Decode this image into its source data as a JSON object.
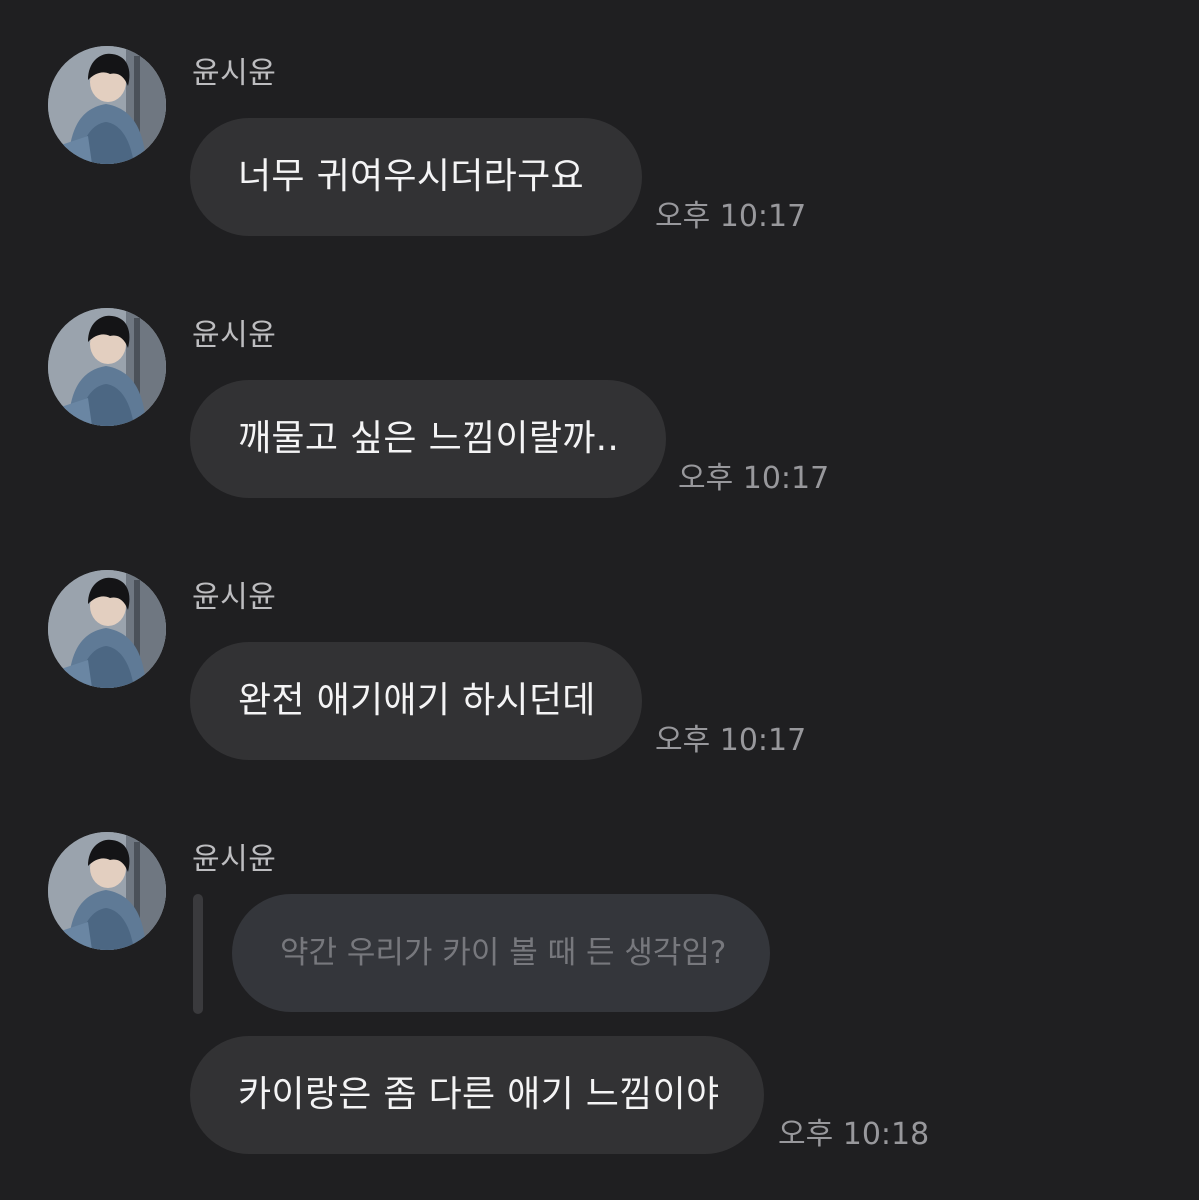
{
  "messages": [
    {
      "sender": "윤시윤",
      "text": "너무 귀여우시더라구요",
      "time": "오후 10:17"
    },
    {
      "sender": "윤시윤",
      "text": "깨물고 싶은 느낌이랄까..",
      "time": "오후 10:17"
    },
    {
      "sender": "윤시윤",
      "text": "완전 애기애기 하시던데",
      "time": "오후 10:17"
    },
    {
      "sender": "윤시윤",
      "quote": "약간 우리가 카이 볼 때 든 생각임?",
      "text": "카이랑은 좀 다른 애기 느낌이야",
      "time": "오후 10:18"
    }
  ],
  "theme": {
    "background": "#1f1f21",
    "bubble": "#323234",
    "quote_bubble": "#34363b",
    "time_color": "#98989c"
  }
}
